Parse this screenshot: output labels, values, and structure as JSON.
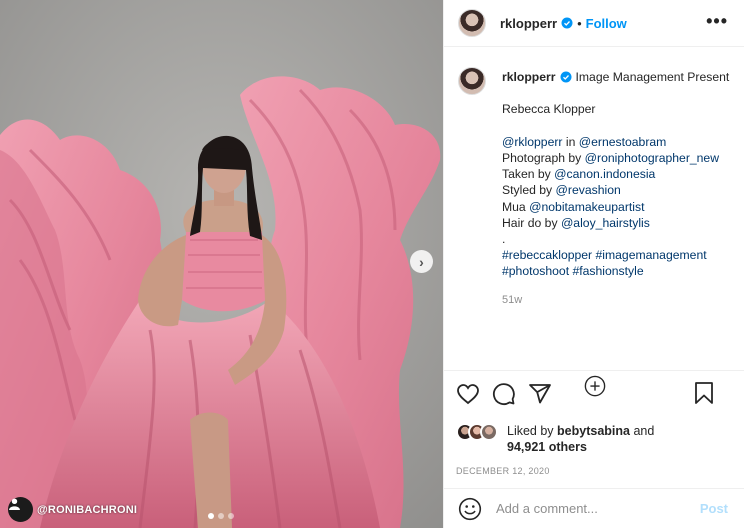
{
  "header": {
    "username": "rklopperr",
    "follow_label": "Follow",
    "separator": "•",
    "more_label": "•••"
  },
  "caption": {
    "username": "rklopperr",
    "intro": "Image Management Present",
    "title": "Rebecca Klopper",
    "lines": [
      {
        "prefix": "",
        "link": "@rklopperr",
        "mid": " in ",
        "link2": "@ernestoabram"
      },
      {
        "prefix": "Photograph by ",
        "link": "@roniphotographer_new"
      },
      {
        "prefix": "Taken by ",
        "link": "@canon.indonesia"
      },
      {
        "prefix": "Styled by ",
        "link": "@revashion"
      },
      {
        "prefix": "Mua ",
        "link": "@nobitamakeupartist"
      },
      {
        "prefix": "Hair do by ",
        "link": "@aloy_hairstylis"
      }
    ],
    "dot_line": ".",
    "hashtags_line1": "#rebeccaklopper #imagemanagement",
    "hashtags_line2": "#photoshoot #fashionstyle",
    "time_ago": "51w"
  },
  "media": {
    "watermark": "@RONIBACHRONI",
    "next_glyph": "›",
    "carousel_count": 3,
    "carousel_active": 1
  },
  "likes": {
    "liked_by_prefix": "Liked by ",
    "liked_by_user": "bebytsabina",
    "and": " and",
    "count": "94,921 others"
  },
  "date": "DECEMBER 12, 2020",
  "comment": {
    "placeholder": "Add a comment...",
    "post_label": "Post"
  },
  "colors": {
    "accent": "#0095f6",
    "link": "#00376b",
    "muted": "#8e8e8e",
    "post_disabled": "#b2dffc",
    "dress_pink": "#e98aa0"
  }
}
